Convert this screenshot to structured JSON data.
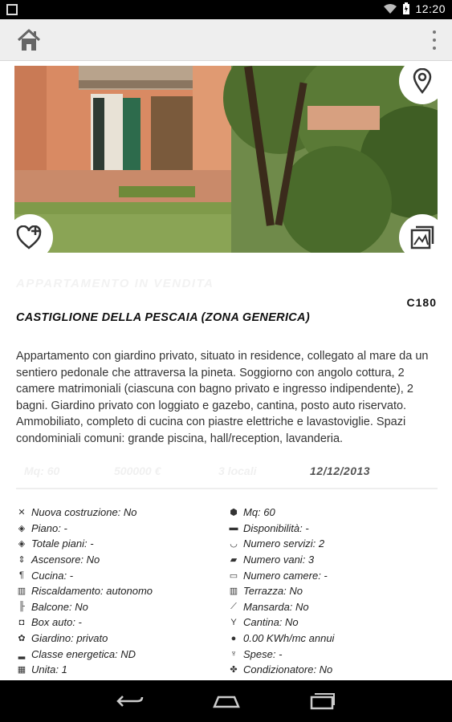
{
  "status_bar": {
    "time": "12:20"
  },
  "listing": {
    "watermark": "APPARTAMENTO  IN  VENDITA",
    "code": "C180",
    "title": "CASTIGLIONE DELLA PESCAIA (ZONA GENERICA)",
    "description": "Appartamento con giardino privato, situato in residence, collegato al mare da un sentiero pedonale che attraversa la pineta. Soggiorno con angolo cottura, 2 camere matrimoniali (ciascuna con bagno privato e ingresso indipendente), 2 bagni. Giardino privato con loggiato e gazebo, cantina, posto auto riservato. Ammobiliato, completo di cucina con piastre elettriche e lavastoviglie. Spazi condominiali comuni: grande piscina, hall/reception, lavanderia.",
    "summary": {
      "mq": "Mq: 60",
      "price": "500000 €",
      "rooms": "3 locali",
      "date": "12/12/2013"
    }
  },
  "details_left": [
    {
      "icon": "wrench-icon",
      "text": "Nuova costruzione: No"
    },
    {
      "icon": "layers-icon",
      "text": "Piano: -"
    },
    {
      "icon": "layers-icon",
      "text": "Totale piani: -"
    },
    {
      "icon": "elevator-icon",
      "text": "Ascensore: No"
    },
    {
      "icon": "cutlery-icon",
      "text": "Cucina: -"
    },
    {
      "icon": "radiator-icon",
      "text": "Riscaldamento: autonomo"
    },
    {
      "icon": "balcony-icon",
      "text": "Balcone: No"
    },
    {
      "icon": "car-icon",
      "text": "Box auto: -"
    },
    {
      "icon": "flower-icon",
      "text": "Giardino: privato"
    },
    {
      "icon": "energy-bars-icon",
      "text": "Classe energetica: ND"
    },
    {
      "icon": "building-icon",
      "text": "Unita: 1"
    }
  ],
  "details_right": [
    {
      "icon": "cube-icon",
      "text": "Mq: 60"
    },
    {
      "icon": "briefcase-icon",
      "text": "Disponibilità: -"
    },
    {
      "icon": "bathtub-icon",
      "text": "Numero servizi: 2"
    },
    {
      "icon": "sofa-icon",
      "text": "Numero vani: 3"
    },
    {
      "icon": "bed-icon",
      "text": "Numero camere: -"
    },
    {
      "icon": "terrace-icon",
      "text": "Terrazza: No"
    },
    {
      "icon": "attic-icon",
      "text": "Mansarda: No"
    },
    {
      "icon": "wine-glass-icon",
      "text": "Cantina: No"
    },
    {
      "icon": "power-icon",
      "text": "0.00 KWh/mc annui"
    },
    {
      "icon": "coins-icon",
      "text": "Spese: -"
    },
    {
      "icon": "fan-icon",
      "text": "Condizionatore: No"
    }
  ]
}
